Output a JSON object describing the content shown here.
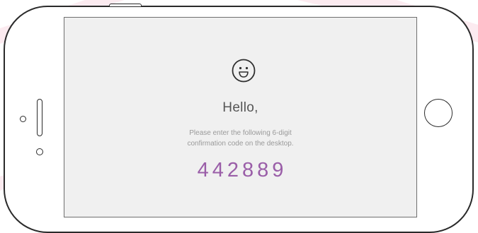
{
  "screen": {
    "greeting": "Hello,",
    "message_line1": "Please enter the following 6-digit",
    "message_line2": "confirmation code on the desktop.",
    "confirmation_code": "442889",
    "icon": "smiley-face-icon"
  },
  "colors": {
    "code_accent": "#9a5ea8",
    "screen_background": "#f0f0f0",
    "greeting_text": "#555555",
    "message_text": "#9a9a9a",
    "background_stripe": "#f9dde4",
    "device_outline": "#2a2a2a"
  }
}
